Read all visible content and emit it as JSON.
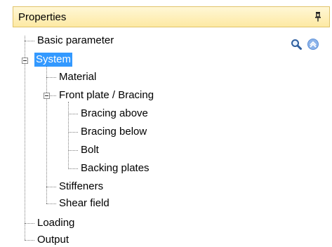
{
  "panel": {
    "title": "Properties",
    "pin_icon": "pin-icon"
  },
  "toolbar": {
    "search_icon": "search-icon",
    "collapse_icon": "collapse-up-icon"
  },
  "tree": {
    "basic_parameter": "Basic parameter",
    "system": "System",
    "material": "Material",
    "front_plate_bracing": "Front plate / Bracing",
    "bracing_above": "Bracing above",
    "bracing_below": "Bracing below",
    "bolt": "Bolt",
    "backing_plates": "Backing plates",
    "stiffeners": "Stiffeners",
    "shear_field": "Shear field",
    "loading": "Loading",
    "output": "Output"
  },
  "colors": {
    "header_bg": "#fde9a3",
    "header_border": "#e0c36a",
    "selection": "#3399ff",
    "collapse_icon": "#5b8fd8"
  }
}
